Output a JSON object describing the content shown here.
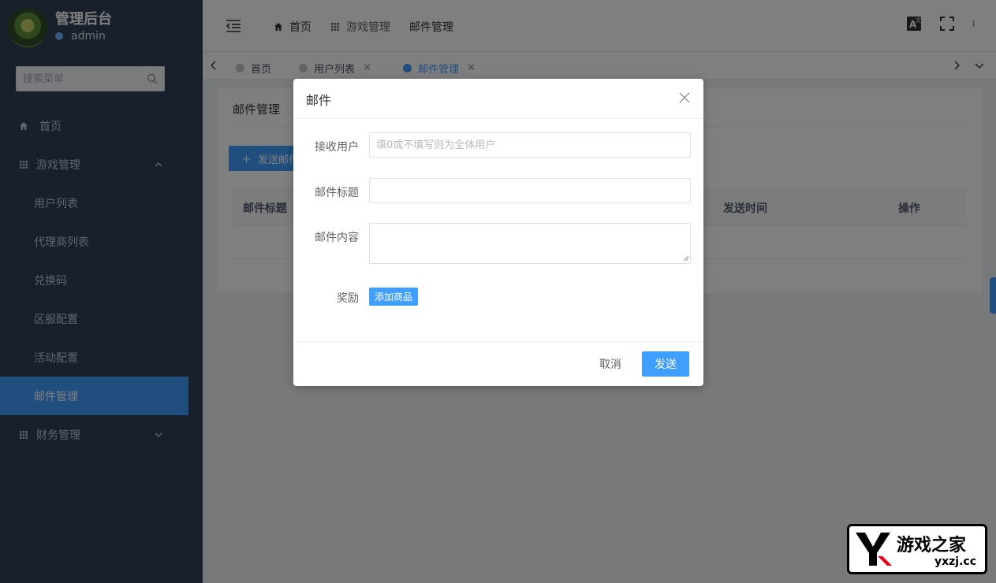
{
  "colors": {
    "sidebar_bg": "#304156",
    "accent": "#409eff",
    "overlay": "rgba(0,0,0,0.5)"
  },
  "sidebar": {
    "app_title": "管理后台",
    "username": "admin",
    "search_placeholder": "搜索菜单",
    "home": "首页",
    "game_group": "游戏管理",
    "game_items": [
      {
        "label": "用户列表"
      },
      {
        "label": "代理商列表"
      },
      {
        "label": "兑换码"
      },
      {
        "label": "区服配置"
      },
      {
        "label": "活动配置"
      },
      {
        "label": "邮件管理",
        "active": true
      }
    ],
    "finance_group": "财务管理"
  },
  "navbar": {
    "breadcrumb": [
      "首页",
      "游戏管理",
      "邮件管理"
    ],
    "icons": [
      "hamburger-icon",
      "home-icon",
      "grid-icon",
      "translate-icon",
      "fullscreen-icon",
      "more-vertical-icon"
    ]
  },
  "tags": [
    {
      "label": "首页"
    },
    {
      "label": "用户列表",
      "closable": true
    },
    {
      "label": "邮件管理",
      "closable": true,
      "active": true
    }
  ],
  "page": {
    "heading": "邮件管理",
    "send_button": "发送邮件",
    "columns": [
      "邮件标题",
      "发送时间",
      "操作"
    ]
  },
  "dialog": {
    "title": "邮件",
    "recipient_label": "接收用户",
    "recipient_placeholder": "填0或不填写则为全体用户",
    "subject_label": "邮件标题",
    "subject_value": "",
    "body_label": "邮件内容",
    "body_value": "",
    "reward_label": "奖励",
    "add_goods": "添加商品",
    "cancel": "取消",
    "send": "发送"
  },
  "badge": {
    "name": "游戏之家",
    "url": "yxzj.cc"
  }
}
